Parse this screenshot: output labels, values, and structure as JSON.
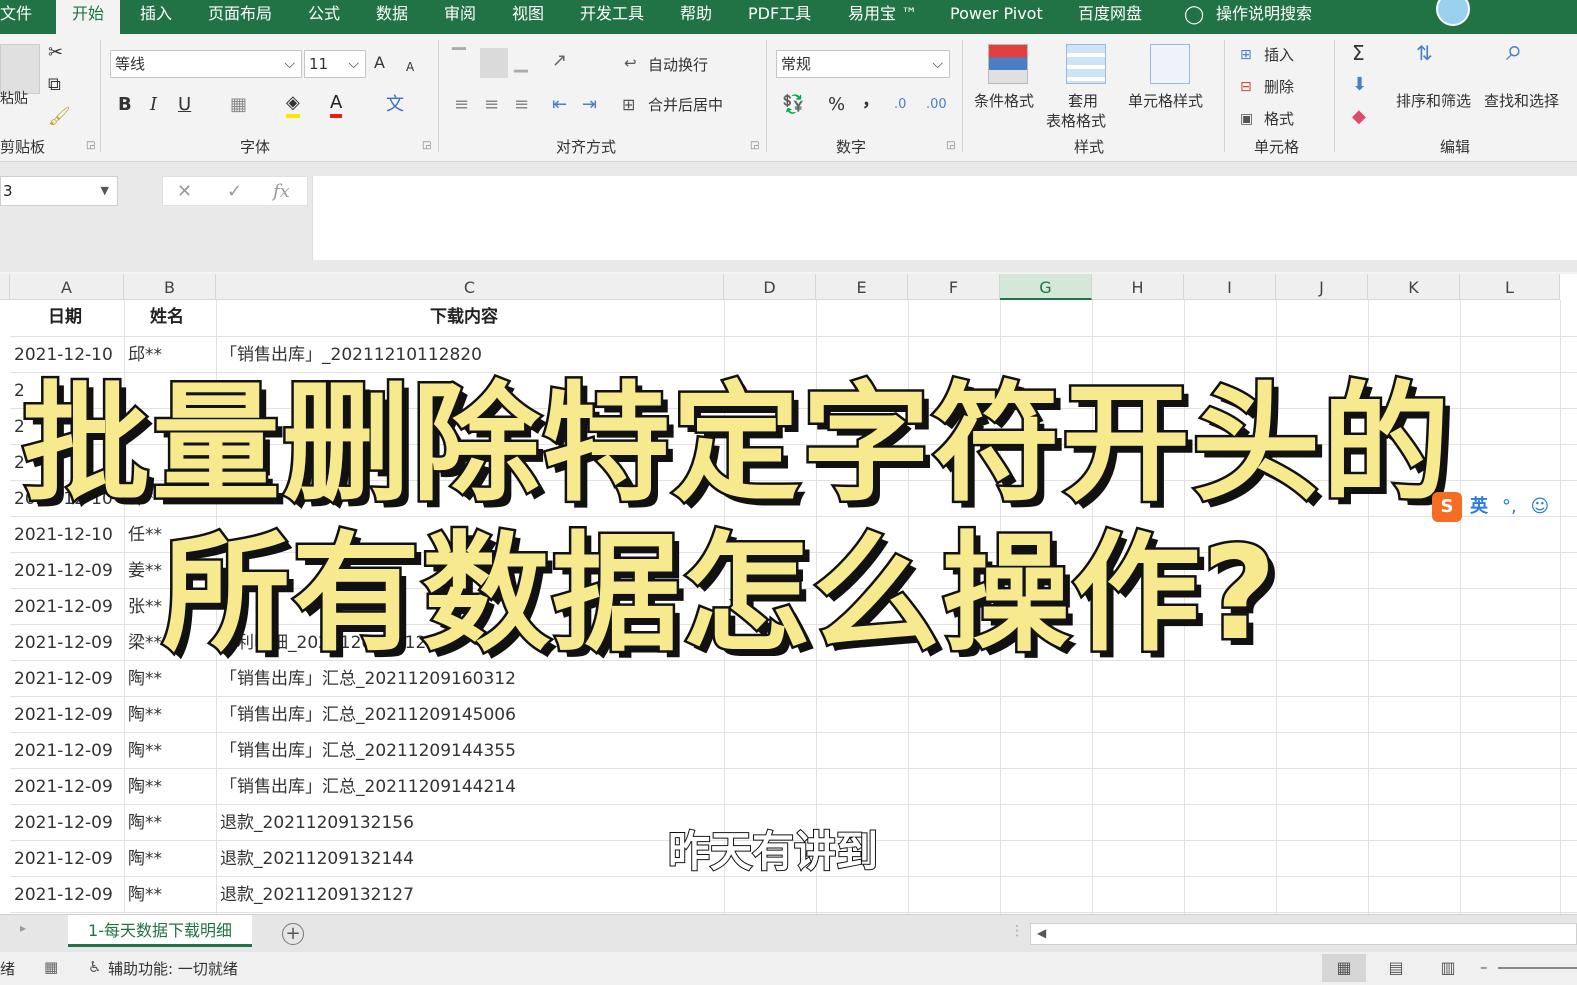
{
  "ribbon_tabs": [
    "文件",
    "开始",
    "插入",
    "页面布局",
    "公式",
    "数据",
    "审阅",
    "视图",
    "开发工具",
    "帮助",
    "PDF工具",
    "易用宝 ™",
    "Power Pivot",
    "百度网盘",
    "操作说明搜索"
  ],
  "clipboard": {
    "paste": "粘贴",
    "group": "剪贴板"
  },
  "font": {
    "name": "等线",
    "size": "11",
    "bold": "B",
    "italic": "I",
    "underline": "U",
    "grow": "A",
    "shrink": "A",
    "group": "字体"
  },
  "align": {
    "wrap": "自动换行",
    "merge": "合并后居中",
    "group": "对齐方式"
  },
  "number": {
    "format": "常规",
    "percent": "%",
    "comma": "，",
    "group": "数字"
  },
  "styles": {
    "cond": "条件格式",
    "table1": "套用",
    "table2": "表格格式",
    "cell": "单元格样式",
    "group": "样式"
  },
  "cells": {
    "insert": "插入",
    "delete": "删除",
    "format": "格式",
    "group": "单元格"
  },
  "editing": {
    "sigma": "Σ",
    "sort": "排序和筛选",
    "find": "查找和选择",
    "group": "编辑"
  },
  "formula_bar": {
    "namebox": "3",
    "cancel": "✕",
    "enter": "✓",
    "fx": "fx"
  },
  "columns": [
    "A",
    "B",
    "C",
    "D",
    "E",
    "F",
    "G",
    "H",
    "I",
    "J",
    "K",
    "L"
  ],
  "selected_column": "G",
  "header_row": {
    "a": "日期",
    "b": "姓名",
    "c": "下载内容"
  },
  "rows": [
    {
      "a": "2021-12-10",
      "b": "邱**",
      "c": "「销售出库」_20211210112820"
    },
    {
      "a": "2",
      "b": "",
      "c": ""
    },
    {
      "a": "2",
      "b": "",
      "c": ""
    },
    {
      "a": "2",
      "b": "",
      "c": ""
    },
    {
      "a": "2021-12-10",
      "b": "许**",
      "c": ""
    },
    {
      "a": "2021-12-10",
      "b": "任**",
      "c": ""
    },
    {
      "a": "2021-12-09",
      "b": "姜**",
      "c": ""
    },
    {
      "a": "2021-12-09",
      "b": "张**",
      "c": ""
    },
    {
      "a": "2021-12-09",
      "b": "梁**",
      "c": "净利明细_20211209151209"
    },
    {
      "a": "2021-12-09",
      "b": "陶**",
      "c": "「销售出库」汇总_20211209160312"
    },
    {
      "a": "2021-12-09",
      "b": "陶**",
      "c": "「销售出库」汇总_20211209145006"
    },
    {
      "a": "2021-12-09",
      "b": "陶**",
      "c": "「销售出库」汇总_20211209144355"
    },
    {
      "a": "2021-12-09",
      "b": "陶**",
      "c": "「销售出库」汇总_20211209144214"
    },
    {
      "a": "2021-12-09",
      "b": "陶**",
      "c": "退款_20211209132156"
    },
    {
      "a": "2021-12-09",
      "b": "陶**",
      "c": "退款_20211209132144"
    },
    {
      "a": "2021-12-09",
      "b": "陶**",
      "c": "退款_20211209132127"
    }
  ],
  "overlay": {
    "line1": "批量删除特定字符开头的",
    "line2": "所有数据怎么操作?",
    "subtitle": "昨天有讲到"
  },
  "ime": {
    "logo": "S",
    "lang": "英"
  },
  "sheet_tab": "1-每天数据下载明细",
  "add_sheet": "+",
  "status": {
    "ready": "绪",
    "accessibility": "辅助功能: 一切就绪"
  }
}
